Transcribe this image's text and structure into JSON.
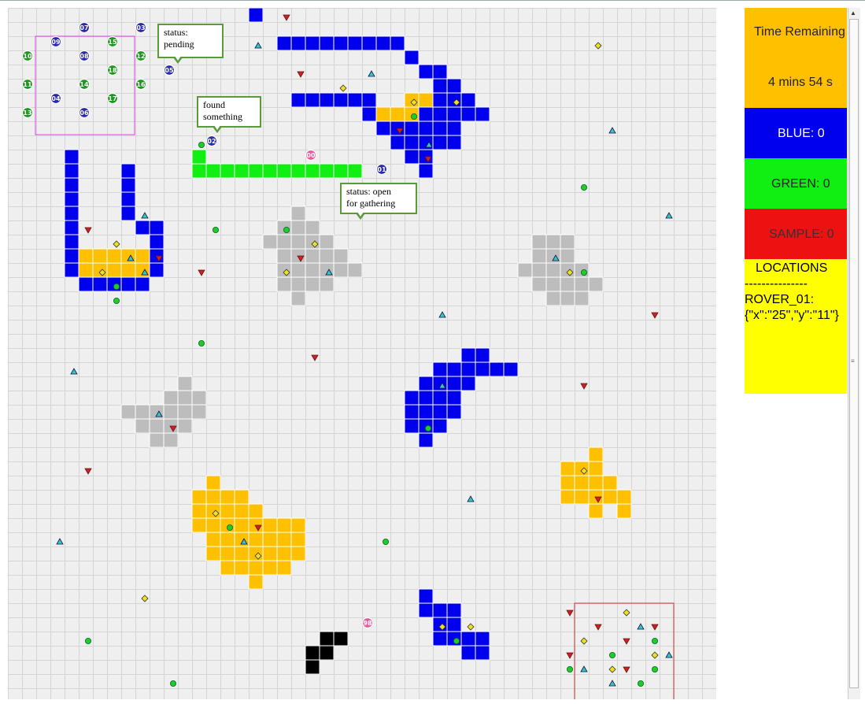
{
  "panel": {
    "time_label": "Time Remaining",
    "time_value": "4 mins 54 s",
    "blue_score": "BLUE: 0",
    "green_score": "GREEN: 0",
    "sample_score": "SAMPLE: 0",
    "locations_title": "LOCATIONS",
    "locations_divider": "---------------",
    "rover_line": "ROVER_01:",
    "rover_coords": "{\"x\":\"25\",\"y\":\"11\"}"
  },
  "bubbles": {
    "pending": [
      "status:",
      "pending"
    ],
    "found": [
      "found",
      "something"
    ],
    "open": [
      "status: open",
      "for gathering"
    ]
  },
  "colors": {
    "blue": "#0000ee",
    "green": "#11ee11",
    "yellow_terrain": "#ffc000",
    "gray_terrain": "#bdbdbd",
    "black_terrain": "#000000",
    "grid_bg": "#efefef",
    "grid_line": "#d4d4d4",
    "rover_blue": "#2a2ab0",
    "rover_green": "#1a9a1a",
    "rover_pink": "#e85a9a"
  },
  "icons": [
    "triangle-marker-icon",
    "inverted-triangle-marker-icon",
    "diamond-marker-icon",
    "circle-marker-icon"
  ],
  "rovers": [
    {
      "id": "07",
      "team": "blue"
    },
    {
      "id": "03",
      "team": "blue"
    },
    {
      "id": "09",
      "team": "blue"
    },
    {
      "id": "15",
      "team": "green"
    },
    {
      "id": "10",
      "team": "green"
    },
    {
      "id": "08",
      "team": "blue"
    },
    {
      "id": "12",
      "team": "green"
    },
    {
      "id": "05",
      "team": "blue"
    },
    {
      "id": "18",
      "team": "green"
    },
    {
      "id": "11",
      "team": "green"
    },
    {
      "id": "14",
      "team": "green"
    },
    {
      "id": "16",
      "team": "green"
    },
    {
      "id": "04",
      "team": "blue"
    },
    {
      "id": "17",
      "team": "green"
    },
    {
      "id": "13",
      "team": "green"
    },
    {
      "id": "06",
      "team": "blue"
    },
    {
      "id": "02",
      "team": "blue"
    },
    {
      "id": "00",
      "team": "pink"
    },
    {
      "id": "01",
      "team": "blue"
    },
    {
      "id": "98",
      "team": "pink"
    }
  ]
}
